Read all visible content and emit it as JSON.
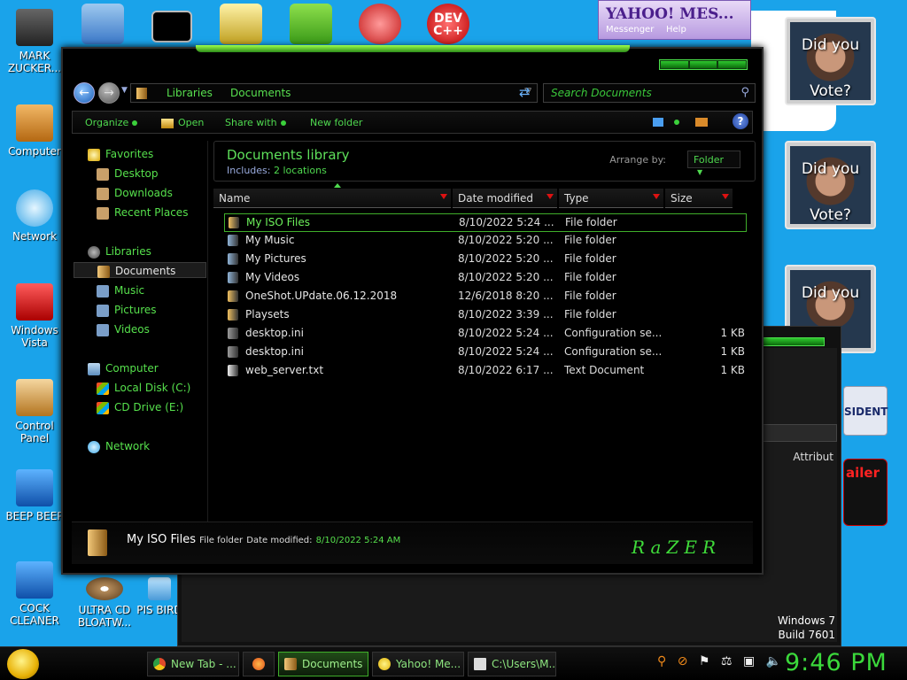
{
  "desktop": {
    "icons": [
      {
        "label": "MARK ZUCKER...",
        "color": "#3a3a3a"
      },
      {
        "label": "Computer",
        "color": "#d88a1f"
      },
      {
        "label": "Network",
        "color": "#4ab7ef"
      },
      {
        "label": "Windows Vista",
        "color": "#d42828"
      },
      {
        "label": "Control Panel",
        "color": "#d6a14a"
      },
      {
        "label": "BEEP BEEP",
        "color": "#1e6fd0"
      },
      {
        "label": "COCK CLEANER",
        "color": "#1e6fd0"
      },
      {
        "label": "ULTRA CD BLOATW...",
        "color": "#8a6440"
      },
      {
        "label": "PIS BIRD",
        "color": "#5fb3e8"
      }
    ],
    "top_icons": [
      {
        "label": "dev-icon",
        "text": "DEV C++"
      }
    ]
  },
  "yahoo": {
    "title": "YAHOO! MES...",
    "menu1": "Messenger",
    "menu2": "Help"
  },
  "side_cards": [
    {
      "line1": "Did you",
      "line2": "Vote?"
    },
    {
      "line1": "Did you",
      "line2": "Vote?"
    },
    {
      "line1": "Did you",
      "line2": "?"
    }
  ],
  "side_labels": {
    "president": "SIDENT",
    "trailer": "ailer"
  },
  "bg_window": {
    "attr": "Attribut",
    "os_line1": "Windows 7",
    "os_line2": "Build 7601"
  },
  "explorer": {
    "breadcrumbs": [
      "Libraries",
      "Documents"
    ],
    "search_placeholder": "Search Documents",
    "toolbar": {
      "organize": "Organize",
      "open": "Open",
      "share": "Share with",
      "new_folder": "New folder"
    },
    "nav": {
      "favorites": "Favorites",
      "desktop": "Desktop",
      "downloads": "Downloads",
      "recent": "Recent Places",
      "libraries": "Libraries",
      "documents": "Documents",
      "music": "Music",
      "pictures": "Pictures",
      "videos": "Videos",
      "computer": "Computer",
      "local_disk": "Local Disk (C:)",
      "cd_drive": "CD Drive (E:)",
      "network": "Network"
    },
    "library": {
      "title": "Documents library",
      "includes_label": "Includes:",
      "includes_value": "2 locations",
      "arrange_label": "Arrange by:",
      "arrange_value": "Folder"
    },
    "columns": {
      "name": "Name",
      "date": "Date modified",
      "type": "Type",
      "size": "Size"
    },
    "files": [
      {
        "name": "My ISO Files",
        "date": "8/10/2022 5:24 ...",
        "type": "File folder",
        "size": "",
        "color": "#f0c060"
      },
      {
        "name": "My Music",
        "date": "8/10/2022 5:20 ...",
        "type": "File folder",
        "size": "",
        "color": "#8fb3d6"
      },
      {
        "name": "My Pictures",
        "date": "8/10/2022 5:20 ...",
        "type": "File folder",
        "size": "",
        "color": "#8fb3d6"
      },
      {
        "name": "My Videos",
        "date": "8/10/2022 5:20 ...",
        "type": "File folder",
        "size": "",
        "color": "#8fb3d6"
      },
      {
        "name": "OneShot.UPdate.06.12.2018",
        "date": "12/6/2018 8:20 ...",
        "type": "File folder",
        "size": "",
        "color": "#f0c060"
      },
      {
        "name": "Playsets",
        "date": "8/10/2022 3:39 ...",
        "type": "File folder",
        "size": "",
        "color": "#f0c060"
      },
      {
        "name": "desktop.ini",
        "date": "8/10/2022 5:24 ...",
        "type": "Configuration se...",
        "size": "1 KB",
        "color": "#9a9a9a"
      },
      {
        "name": "desktop.ini",
        "date": "8/10/2022 5:24 ...",
        "type": "Configuration se...",
        "size": "1 KB",
        "color": "#9a9a9a"
      },
      {
        "name": "web_server.txt",
        "date": "8/10/2022 6:17 ...",
        "type": "Text Document",
        "size": "1 KB",
        "color": "#eeeeee"
      }
    ],
    "details": {
      "name": "My ISO Files",
      "type": "File folder",
      "date_label": "Date modified:",
      "date_value": "8/10/2022 5:24 AM"
    },
    "brand": "RaZER"
  },
  "taskbar": {
    "buttons": [
      {
        "label": "New Tab - ...",
        "color": "#e04a2a"
      },
      {
        "label": "",
        "color": "#f07a1a"
      },
      {
        "label": "Documents",
        "color": "#f0c060"
      },
      {
        "label": "Yahoo! Me...",
        "color": "#f5d000"
      },
      {
        "label": "C:\\Users\\M...",
        "color": "#cccccc"
      }
    ],
    "clock": "9:46 PM"
  }
}
